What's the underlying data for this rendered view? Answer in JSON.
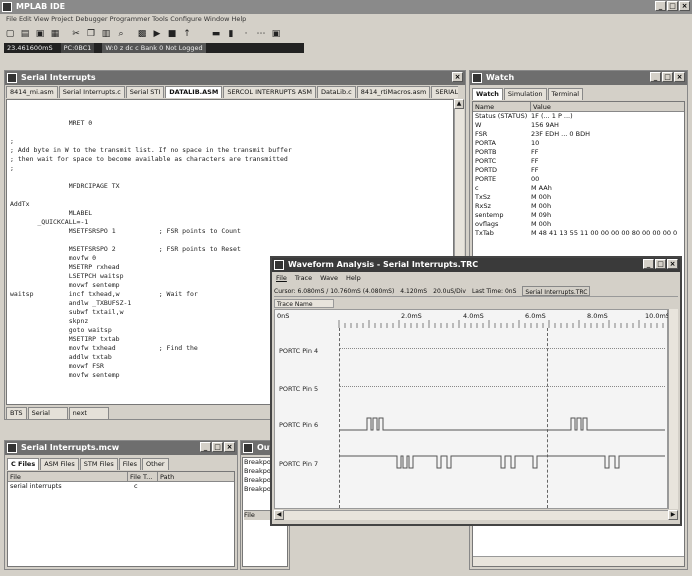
{
  "app": {
    "title": "MPLAB IDE",
    "menu": "File  Edit  View  Project  Debugger  Programmer  Tools  Configure  Window  Help",
    "status_time": "23.461600mS",
    "status_pc": "PC:0BC1",
    "status_info": "W:0  z dc c  Bank 0  Not Logged"
  },
  "toolbar": {
    "icons": [
      "new-icon",
      "open-icon",
      "save-icon",
      "print-icon",
      "cut-icon",
      "copy-icon",
      "paste-icon",
      "find-icon",
      "build-icon",
      "run-icon",
      "halt-icon",
      "step-icon",
      "reset-icon",
      "chart-icon",
      "step-into-icon",
      "step-over-icon",
      "breakpoint-icon"
    ]
  },
  "editor": {
    "title": "Serial Interrupts",
    "tabs": [
      "8414_mi.asm",
      "Serial Interrupts.c",
      "Serial STI",
      "DATALIB.ASM",
      "SERCOL INTERRUPTS ASM",
      "DataLib.c",
      "8414_rtiMacros.asm",
      "SERIAL INT1"
    ],
    "active_tab": 3,
    "lines": [
      "               MRET 0",
      "",
      ";",
      "; Add byte in W to the transmit list. If no space in the transmit buffer",
      "; then wait for space to become available as characters are transmitted",
      ";",
      "",
      "               MFDRCIPAGE TX",
      "",
      "AddTx",
      "               MLABEL",
      "       _QUICKCALL=-1",
      "               MSETFSRSPO 1           ; FSR points to Count",
      "",
      "               MSETFSRSPO 2           ; FSR points to Reset",
      "               movfw 0",
      "               MSETRP rxhead",
      "               LSETPCH waitsp",
      "               movwf sentemp",
      "waitsp         incf txhead,w          ; Wait for",
      "               andlw _TXBUFSZ-1",
      "               subwf txtail,w",
      "               skpnz",
      "               goto waitsp",
      "               MSETIRP txtab",
      "               movfw txhead           ; Find the",
      "               addlw txtab",
      "               movwf FSR",
      "               movfw sentemp"
    ],
    "bottom_tabs": [
      "BTS",
      "Serial",
      "next"
    ]
  },
  "watch": {
    "title": "Watch",
    "tabs": [
      "Watch",
      "Simulation",
      "Terminal"
    ],
    "col_name": "Name",
    "col_value": "Value",
    "rows": [
      {
        "name": "Status (STATUS)",
        "value": "1F  (... 1 P ...)"
      },
      {
        "name": "W",
        "value": "156 9AH"
      },
      {
        "name": "FSR",
        "value": "23F EDH ... 0 BDH"
      },
      {
        "name": "PORTA",
        "value": "10"
      },
      {
        "name": "PORTB",
        "value": "FF"
      },
      {
        "name": "PORTC",
        "value": "FF"
      },
      {
        "name": "PORTD",
        "value": "FF"
      },
      {
        "name": "PORTE",
        "value": "00"
      },
      {
        "name": "c",
        "value": "M  AAh"
      },
      {
        "name": "TxSz",
        "value": "M  00h"
      },
      {
        "name": "RxSz",
        "value": "M  00h"
      },
      {
        "name": "sentemp",
        "value": "M  09h"
      },
      {
        "name": "ovflags",
        "value": "M  00h"
      },
      {
        "name": "TxTab",
        "value": "M  48 41 13 55 11 00 00 00 00 80 00 00 00 0"
      }
    ]
  },
  "files": {
    "title": "Serial Interrupts.mcw",
    "tabs": [
      "C Files",
      "ASM Files",
      "STM Files",
      "Files",
      "Other"
    ],
    "col_file": "File",
    "col_type": "File T...",
    "col_path": "Path",
    "rows": [
      {
        "file": "serial interrupts",
        "type": "c",
        "path": ""
      }
    ]
  },
  "output": {
    "title": "Output",
    "lines": [
      "Breakpoi",
      "Breakpoi",
      "Breakpoi",
      "Breakpoi"
    ],
    "file_label": "File"
  },
  "waveform": {
    "title": "Waveform Analysis - Serial Interrupts.TRC",
    "menu": [
      "File",
      "Trace",
      "Wave",
      "Help"
    ],
    "info_cursors": "Cursor: 6.080mS / 10.760mS (4.080mS)",
    "info_value1": "4.120mS",
    "info_value2": "20.0uS/Div",
    "info_last": "Last Time: 0nS",
    "info_file": "Serial Interrupts.TRC",
    "trace_header": "Trace Name",
    "time_start": "0nS",
    "time_labels": [
      "2.0mS",
      "4.0mS",
      "6.0mS",
      "8.0mS",
      "10.0mS"
    ],
    "traces": [
      {
        "name": "PORTC Pin 4"
      },
      {
        "name": "PORTC Pin 5"
      },
      {
        "name": "PORTC Pin 6"
      },
      {
        "name": "PORTC Pin 7"
      }
    ]
  }
}
